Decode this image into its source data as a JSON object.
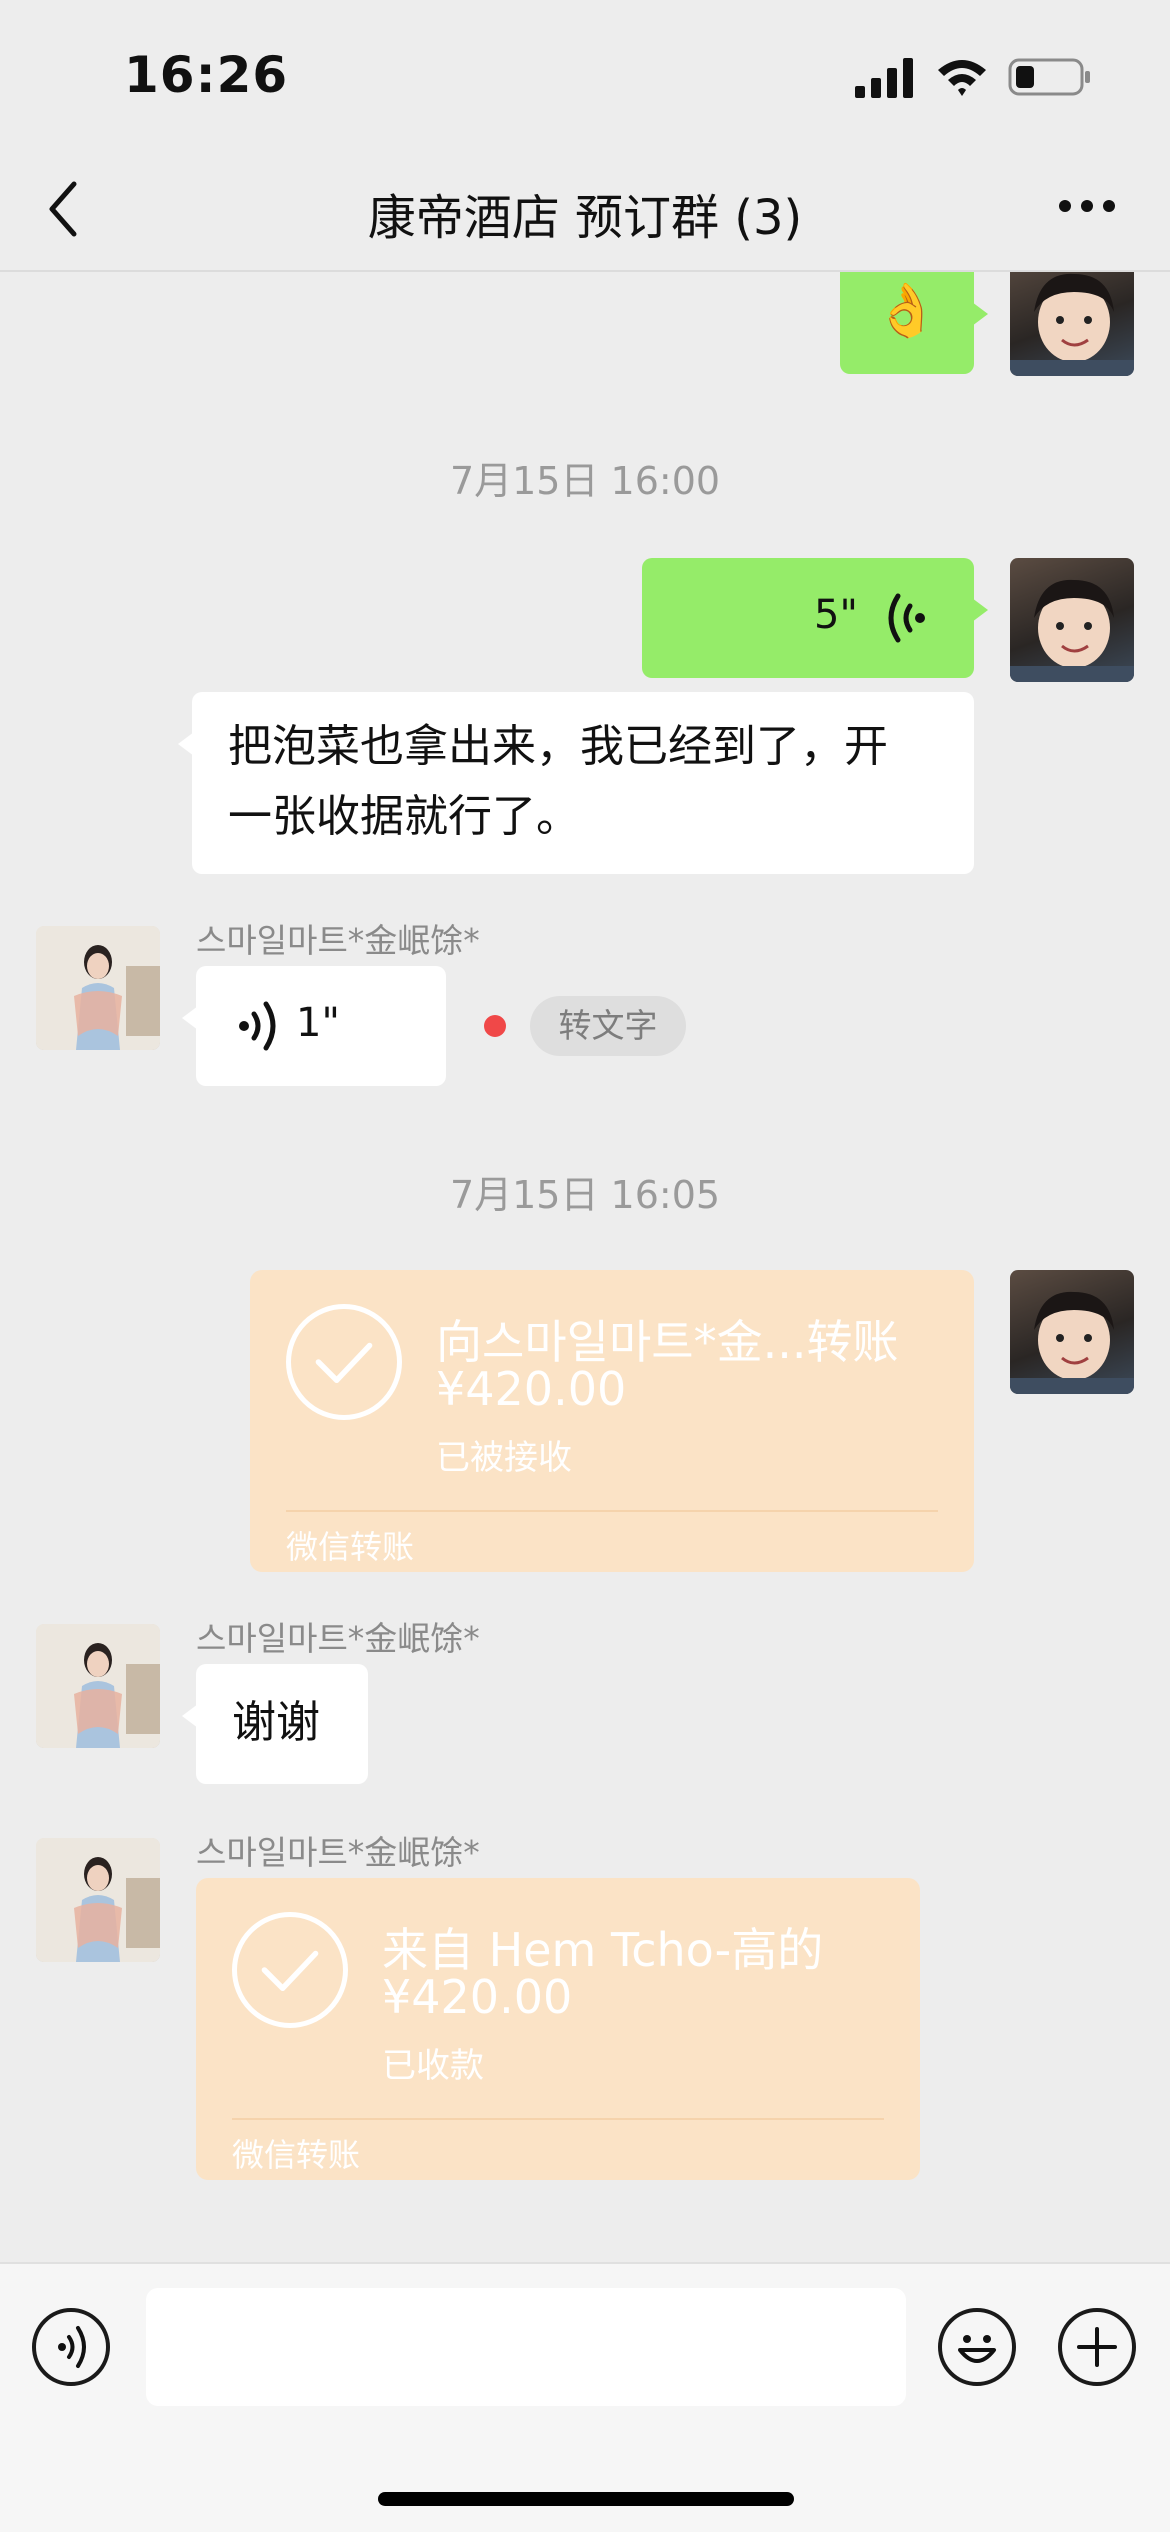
{
  "status_bar": {
    "time": "16:26"
  },
  "header": {
    "title": "康帝酒店 预订群 (3)"
  },
  "messages": {
    "ok_emoji": "👌",
    "timestamp1": "7月15日 16:00",
    "my_voice_duration": "5\"",
    "her_text": "把泡菜也拿出来，我已经到了，开一张收据就行了。",
    "sender_name": "스마일마트*金岷馀*",
    "her_voice_duration": "1\"",
    "convert_to_text": "转文字",
    "timestamp2": "7月15日 16:05",
    "transfer_sent": {
      "title": "向스마일마트*金...转账",
      "amount": "¥420.00",
      "status": "已被接收",
      "footer": "微信转账"
    },
    "thanks": "谢谢",
    "transfer_received": {
      "title": "来自 Hem Tcho-高的",
      "amount": "¥420.00",
      "status": "已收款",
      "footer": "微信转账"
    }
  },
  "colors": {
    "green_bubble": "#95ec69",
    "transfer_bg": "#fbe3c6",
    "background": "#ededed"
  }
}
